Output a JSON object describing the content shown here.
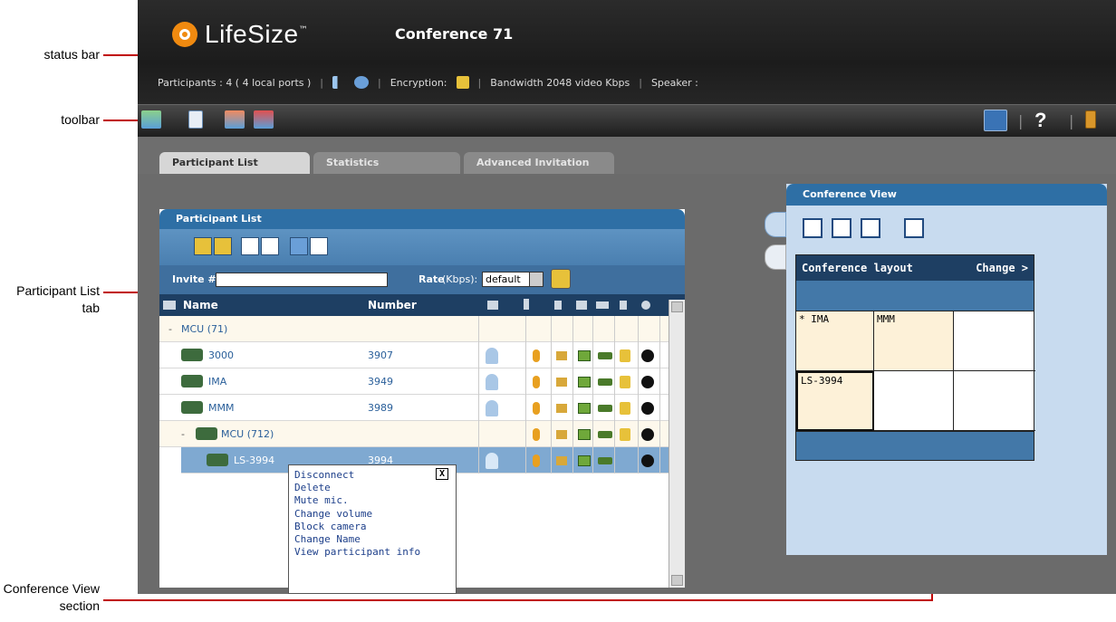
{
  "callouts": {
    "status_bar": "status bar",
    "toolbar": "toolbar",
    "participant_list_tab": "Participant List tab",
    "conference_view_section": "Conference View section"
  },
  "app": {
    "logo_text": "LifeSize",
    "logo_tm": "™",
    "conference_title": "Conference 71",
    "status": {
      "participants": "Participants : 4 ( 4 local ports )",
      "encryption": "Encryption:",
      "bandwidth": "Bandwidth 2048 video Kbps",
      "speaker": "Speaker :"
    },
    "toolbar_icons": [
      "add-participant-icon",
      "copy-icon",
      "remove-participant-icon",
      "disconnect-participant-icon"
    ],
    "toolbar_right_icons": [
      "user-icon",
      "help-icon",
      "exit-icon"
    ],
    "help_label": "?"
  },
  "tabs": [
    {
      "label": "Participant List",
      "active": true
    },
    {
      "label": "Statistics",
      "active": false
    },
    {
      "label": "Advanced Invitation",
      "active": false
    }
  ],
  "participant_list": {
    "title": "Participant List",
    "invite_label": "Invite #",
    "invite_value": "",
    "rate_label": "Rate",
    "rate_unit": "(Kbps):",
    "rate_value": "default",
    "columns": {
      "name": "Name",
      "number": "Number"
    },
    "rows": [
      {
        "name": "MCU (71)",
        "number": "",
        "prefix": "-",
        "type": "group"
      },
      {
        "name": "3000",
        "number": "3907",
        "type": "participant"
      },
      {
        "name": "IMA",
        "number": "3949",
        "type": "participant"
      },
      {
        "name": "MMM",
        "number": "3989",
        "type": "participant"
      },
      {
        "name": "MCU (712)",
        "number": "",
        "prefix": "-",
        "type": "subgroup"
      },
      {
        "name": "LS-3994",
        "number": "3994",
        "type": "selected"
      }
    ]
  },
  "context_menu": {
    "close": "X",
    "items": [
      "Disconnect",
      "Delete",
      "Mute mic.",
      "Change volume",
      "Block camera",
      "Change Name",
      "View participant info"
    ]
  },
  "conference_view": {
    "title": "Conference View",
    "layout_label": "Conference layout",
    "change_label": "Change >",
    "cells": [
      "* IMA",
      "MMM",
      "",
      "LS-3994",
      "",
      ""
    ]
  },
  "colors": {
    "header_blue": "#2e6fa5",
    "dark_blue": "#1e3f63",
    "accent_orange": "#f08a10",
    "callout_red": "#c00000"
  }
}
